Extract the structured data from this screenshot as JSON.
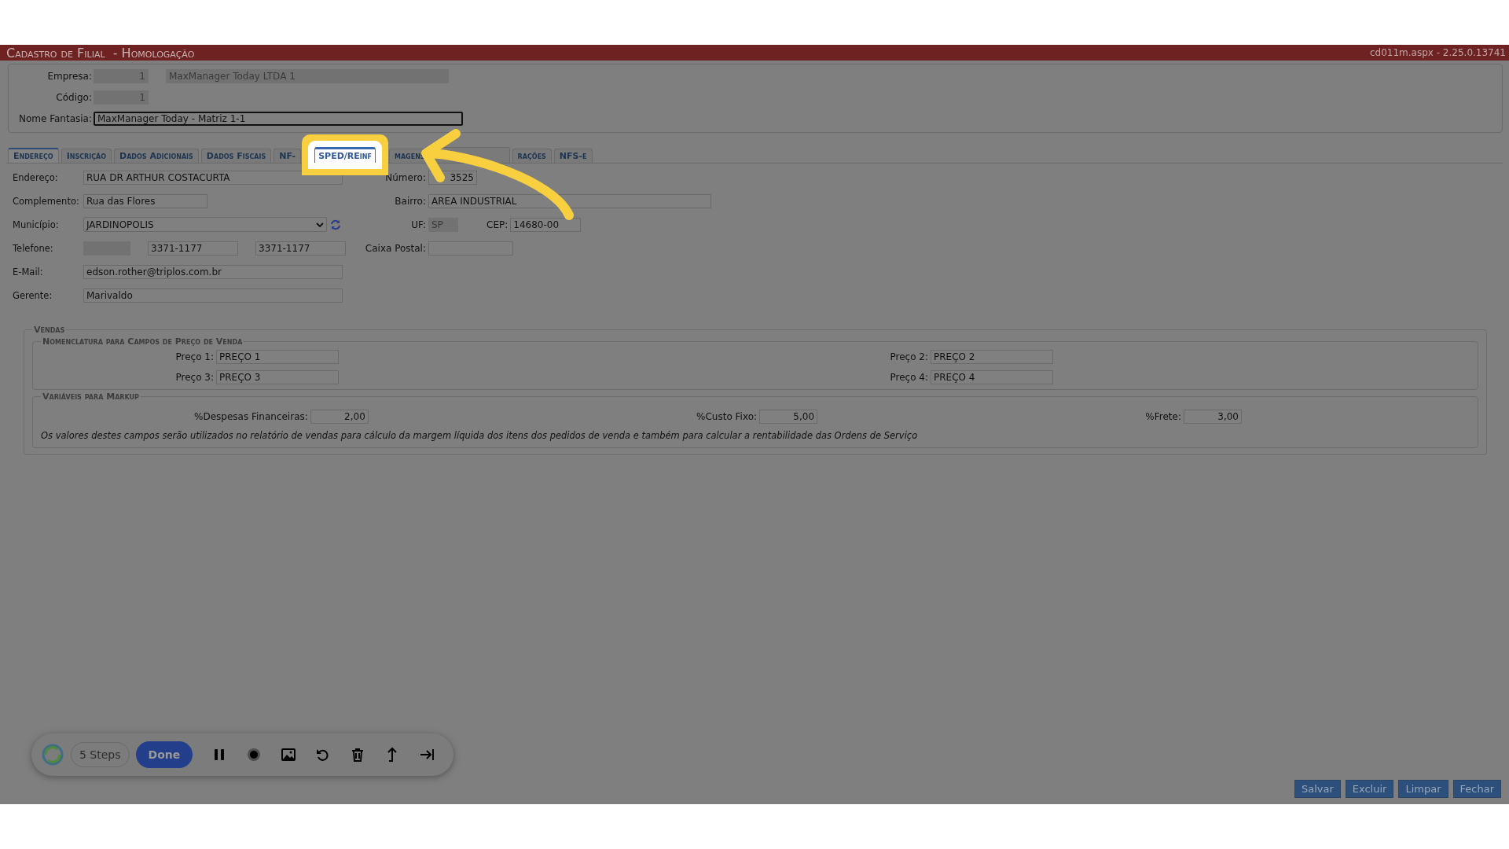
{
  "title_bar": {
    "title": "Cadastro de Filial  - Homologação",
    "version": "cd011m.aspx - 2.25.0.13741"
  },
  "header": {
    "fields": [
      {
        "label": "Empresa:",
        "inputs": [
          {
            "value": "1",
            "disabled": true,
            "kind": "code"
          },
          {
            "value": "MaxManager Today LTDA 1",
            "disabled": true,
            "kind": "wide"
          }
        ]
      },
      {
        "label": "Código:",
        "inputs": [
          {
            "value": "1",
            "disabled": true,
            "kind": "code"
          }
        ]
      },
      {
        "label": "Nome Fantasia:",
        "inputs": [
          {
            "value": "MaxManager Today - Matriz 1-1",
            "disabled": false,
            "kind": "long"
          }
        ]
      }
    ]
  },
  "tabs": [
    {
      "label": "Endereço",
      "selected": true,
      "highlighted": false
    },
    {
      "label": "Inscrição",
      "selected": false,
      "highlighted": false
    },
    {
      "label": "Dados Adicionais",
      "selected": false,
      "highlighted": false
    },
    {
      "label": "Dados Fiscais",
      "selected": false,
      "highlighted": false
    },
    {
      "label": "NF-",
      "selected": false,
      "highlighted": false
    },
    {
      "label": "SPED/REinf",
      "selected": false,
      "highlighted": true
    },
    {
      "label": "magens",
      "selected": false,
      "highlighted": false
    },
    {
      "selected": false,
      "highlighted": false
    },
    {
      "label": "rações",
      "selected": false,
      "highlighted": false
    },
    {
      "label": "NFS-e",
      "selected": false,
      "highlighted": false
    }
  ],
  "address": {
    "rows": [
      {
        "left": {
          "label": "Endereço:",
          "inputs": [
            {
              "value": "RUA DR ARTHUR COSTACURTA",
              "kind": "full",
              "disabled": false
            }
          ]
        },
        "right": [
          {
            "label": "Número:",
            "inputs": [
              {
                "value": "3525",
                "kind": "numero",
                "disabled": false
              }
            ]
          }
        ]
      },
      {
        "left": {
          "label": "Complemento:",
          "inputs": [
            {
              "value": "Rua das Flores",
              "kind": "half",
              "disabled": false
            }
          ]
        },
        "right": [
          {
            "label": "Bairro:",
            "inputs": [
              {
                "value": "AREA INDUSTRIAL",
                "kind": "wide",
                "disabled": false
              }
            ]
          }
        ]
      },
      {
        "left": {
          "label": "Município:",
          "inputs": [
            {
              "value": "JARDINOPOLIS",
              "kind": "select",
              "disabled": false
            }
          ]
        },
        "right": [
          {
            "label": "UF:",
            "inputs": [
              {
                "value": "SP",
                "kind": "tiny",
                "disabled": true
              }
            ]
          },
          {
            "label": "CEP:",
            "inputs": [
              {
                "value": "14680-00",
                "kind": "cep",
                "disabled": false
              }
            ]
          }
        ]
      },
      {
        "left": {
          "label": "Telefone:",
          "inputs": [
            {
              "kind": "ddd",
              "disabled": true
            },
            {
              "value": "3371-1177",
              "kind": "phone",
              "disabled": false
            },
            {
              "value": "3371-1177",
              "kind": "phone",
              "disabled": false
            }
          ]
        },
        "right": [
          {
            "label": "Caixa Postal:",
            "inputs": [
              {
                "kind": "medium",
                "disabled": false
              }
            ]
          }
        ]
      },
      {
        "left": {
          "label": "E-Mail:",
          "inputs": [
            {
              "value": "edson.rother@triplos.com.br",
              "kind": "full",
              "disabled": false
            }
          ]
        },
        "right": []
      },
      {
        "left": {
          "label": "Gerente:",
          "inputs": [
            {
              "value": "Marivaldo",
              "kind": "full",
              "disabled": false
            }
          ]
        },
        "right": []
      }
    ]
  },
  "sales": {
    "legend": "Vendas",
    "prices": {
      "legend": "Nomenclatura para Campos de Preço de Venda",
      "fields": [
        {
          "label": "Preço 1:",
          "value": "PREÇO 1"
        },
        {
          "label": "Preço 2:",
          "value": "PREÇO 2"
        },
        {
          "label": "Preço 3:",
          "value": "PREÇO 3"
        },
        {
          "label": "Preço 4:",
          "value": "PREÇO 4"
        }
      ]
    },
    "markup": {
      "legend": "Variáveis para Markup",
      "fields": [
        {
          "label": "%Despesas Financeiras:",
          "value": "2,00"
        },
        {
          "label": "%Custo Fixo:",
          "value": "5,00"
        },
        {
          "label": "%Frete:",
          "value": "3,00"
        }
      ],
      "note": "Os valores destes campos serão utilizados no relatório de vendas para cálculo da margem líquida dos itens dos pedidos de venda e também para calcular a rentabilidade das Ordens de Serviço"
    }
  },
  "recorder": {
    "steps": "5 Steps",
    "done": "Done"
  },
  "buttons": [
    "Salvar",
    "Excluir",
    "Limpar",
    "Fechar"
  ]
}
